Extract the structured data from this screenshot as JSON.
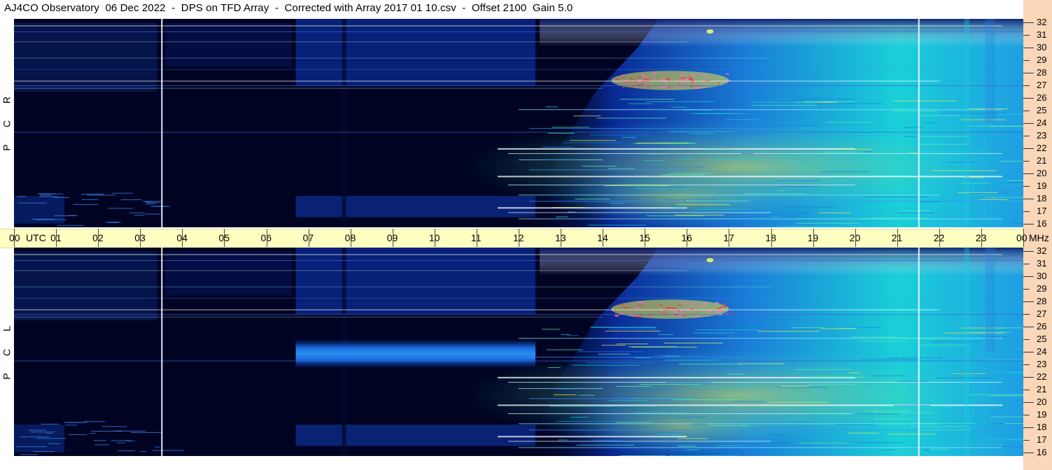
{
  "title": "AJ4CO Observatory  06 Dec 2022  -  DPS on TFD Array  -  Corrected with Array 2017 01 10.csv  -  Offset 2100  Gain 5.0",
  "polarization_top": [
    "R",
    "C",
    "P"
  ],
  "polarization_bottom": [
    "L",
    "C",
    "P"
  ],
  "time_axis_label_utc": "UTC",
  "freq_unit": "MHz",
  "time_ticks": [
    "00",
    "01",
    "02",
    "03",
    "04",
    "05",
    "06",
    "07",
    "08",
    "09",
    "10",
    "11",
    "12",
    "13",
    "14",
    "15",
    "16",
    "17",
    "18",
    "19",
    "20",
    "21",
    "22",
    "23",
    "00"
  ],
  "freq_ticks": [
    "32",
    "31",
    "30",
    "29",
    "28",
    "27",
    "26",
    "25",
    "24",
    "23",
    "22",
    "21",
    "20",
    "19",
    "18",
    "17",
    "16"
  ],
  "colors": {
    "background_dark": "#000422",
    "noise_blue": "#0a2a96",
    "active_cyan": "#1ad0d8",
    "strong_yellow": "#e6f04a",
    "burst_red": "#f03a3a",
    "time_band": "#ffffc2",
    "freq_band": "#fad7b8"
  },
  "chart_data": [
    {
      "type": "heatmap",
      "panel": "RCP",
      "x_axis": {
        "label": "UTC",
        "range_hours": [
          0,
          24
        ]
      },
      "y_axis": {
        "label": "MHz",
        "range": [
          16,
          32
        ]
      },
      "features": [
        {
          "kind": "vertical_marker",
          "time_utc": 3.5
        },
        {
          "kind": "vertical_marker",
          "time_utc": 21.5
        },
        {
          "kind": "receiver_noise_block",
          "time_utc": [
            6.7,
            12.4
          ]
        },
        {
          "kind": "daytime_activity_onset",
          "time_utc": 12.5
        },
        {
          "kind": "intense_band",
          "freq_mhz": [
            26.8,
            28.0
          ],
          "time_utc": [
            14.2,
            17.0
          ]
        }
      ]
    },
    {
      "type": "heatmap",
      "panel": "LCP",
      "x_axis": {
        "label": "UTC",
        "range_hours": [
          0,
          24
        ]
      },
      "y_axis": {
        "label": "MHz",
        "range": [
          16,
          32
        ]
      },
      "features": [
        {
          "kind": "vertical_marker",
          "time_utc": 3.5
        },
        {
          "kind": "vertical_marker",
          "time_utc": 21.5
        },
        {
          "kind": "receiver_noise_block",
          "time_utc": [
            6.7,
            12.4
          ]
        },
        {
          "kind": "bright_band",
          "freq_mhz": [
            22.7,
            25.0
          ],
          "time_utc": [
            6.7,
            12.4
          ]
        },
        {
          "kind": "daytime_activity_onset",
          "time_utc": 12.5
        },
        {
          "kind": "intense_band",
          "freq_mhz": [
            26.8,
            28.0
          ],
          "time_utc": [
            14.2,
            17.0
          ]
        }
      ]
    }
  ]
}
